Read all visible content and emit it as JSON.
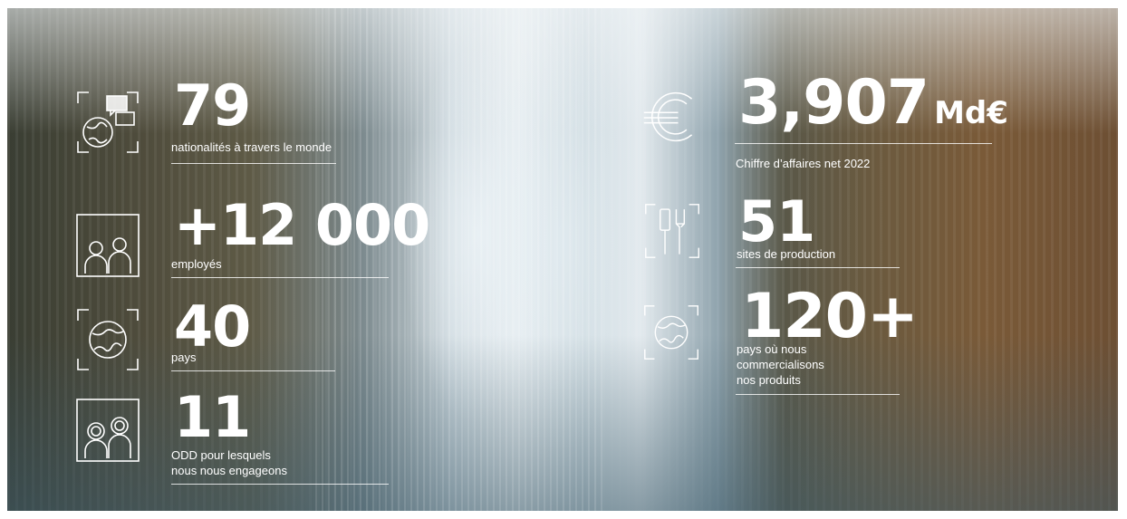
{
  "stats_left": [
    {
      "value": "79",
      "label": "nationalités à travers le monde",
      "icon": "globe-chat-icon"
    },
    {
      "value": "+12 000",
      "label": "employés",
      "icon": "people-icon"
    },
    {
      "value": "40",
      "label": "pays",
      "icon": "globe-icon"
    },
    {
      "value": "11",
      "label": "ODD pour lesquels\nnous nous engageons",
      "icon": "people-circle-icon"
    }
  ],
  "stats_right": [
    {
      "value": "3,907",
      "unit": "Md€",
      "label": "Chiffre d’affaires net 2022",
      "icon": "euro-icon"
    },
    {
      "value": "51",
      "label": "sites de production",
      "icon": "tools-icon"
    },
    {
      "value": "120+",
      "label": "pays où nous\ncommercialisons\nnos produits",
      "icon": "globe-icon"
    }
  ]
}
